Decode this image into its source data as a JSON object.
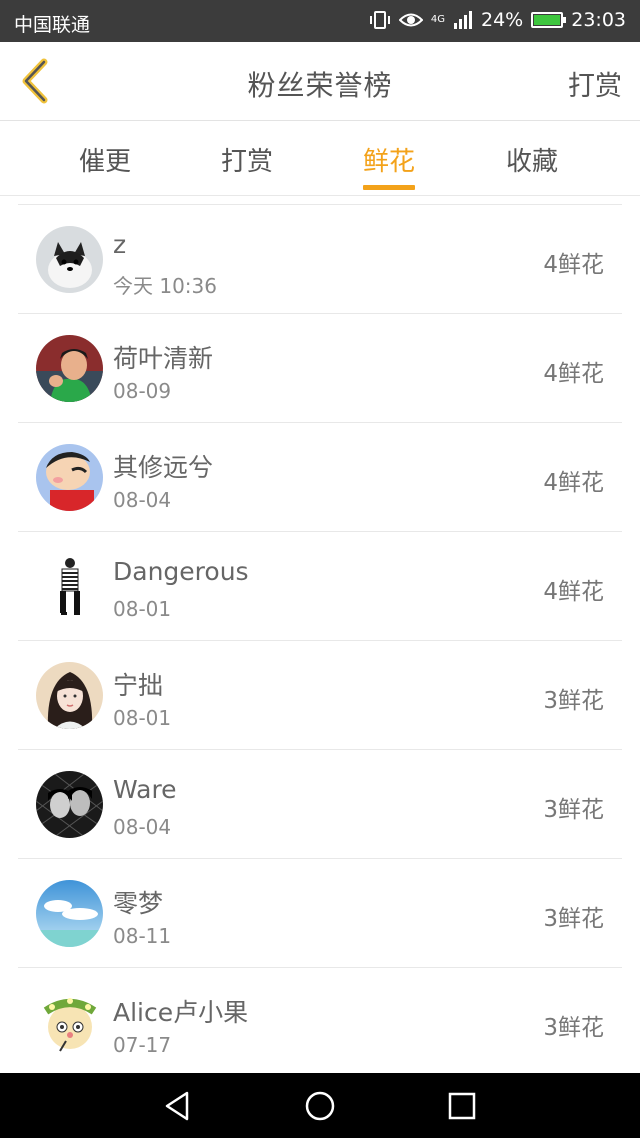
{
  "status_bar": {
    "carrier": "中国联通",
    "battery": "24%",
    "time": "23:03",
    "network": "4G"
  },
  "header": {
    "title": "粉丝荣誉榜",
    "right_action": "打赏"
  },
  "tabs": [
    {
      "label": "催更",
      "active": false
    },
    {
      "label": "打赏",
      "active": false
    },
    {
      "label": "鲜花",
      "active": true
    },
    {
      "label": "收藏",
      "active": false
    }
  ],
  "list": [
    {
      "name": "z",
      "date": "今天 10:36",
      "count": "4鲜花",
      "avatar": "husky-avatar"
    },
    {
      "name": "荷叶清新",
      "date": "08-09",
      "count": "4鲜花",
      "avatar": "boy-photo-avatar"
    },
    {
      "name": "其修远兮",
      "date": "08-04",
      "count": "4鲜花",
      "avatar": "cartoon-avatar"
    },
    {
      "name": "Dangerous",
      "date": "08-01",
      "count": "4鲜花",
      "avatar": "figure-avatar"
    },
    {
      "name": "宁拙",
      "date": "08-01",
      "count": "3鲜花",
      "avatar": "girl-illustration-avatar"
    },
    {
      "name": "Ware",
      "date": "08-04",
      "count": "3鲜花",
      "avatar": "bw-photo-avatar"
    },
    {
      "name": "零梦",
      "date": "08-11",
      "count": "3鲜花",
      "avatar": "sky-avatar"
    },
    {
      "name": "Alice卢小果",
      "date": "07-17",
      "count": "3鲜花",
      "avatar": "flower-crown-avatar"
    }
  ],
  "colors": {
    "accent": "#f3a21a",
    "status_bar_bg": "#3c3c3c",
    "nav_bar_bg": "#000000"
  }
}
